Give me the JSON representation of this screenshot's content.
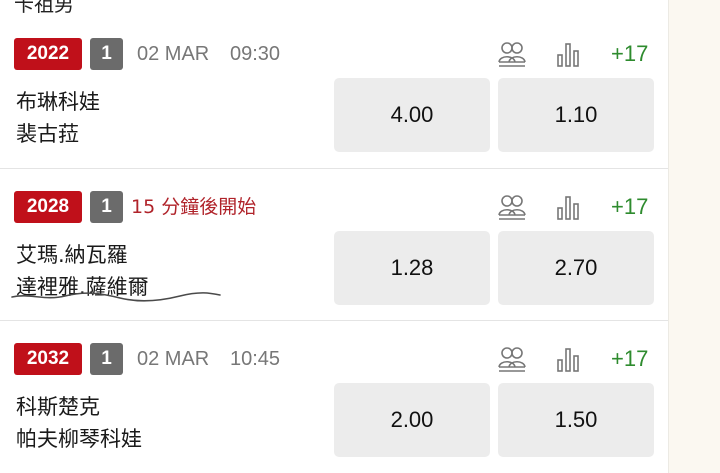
{
  "top_cut_text": "卡祖男",
  "matches": [
    {
      "id": "2022",
      "number": "1",
      "date": "02 MAR",
      "time": "09:30",
      "status": "",
      "more_markets": "+17",
      "home": "布琳科娃",
      "away": "裴古菈",
      "odds": [
        "4.00",
        "1.10"
      ]
    },
    {
      "id": "2028",
      "number": "1",
      "date": "",
      "time": "",
      "status": "15 分鐘後開始",
      "more_markets": "+17",
      "home": "艾瑪.納瓦羅",
      "away": "達裡雅.薩維爾",
      "odds": [
        "1.28",
        "2.70"
      ]
    },
    {
      "id": "2032",
      "number": "1",
      "date": "02 MAR",
      "time": "10:45",
      "status": "",
      "more_markets": "+17",
      "home": "科斯楚克",
      "away": "帕夫柳琴科娃",
      "odds": [
        "2.00",
        "1.50"
      ]
    }
  ],
  "icons": {
    "h2h": "head-to-head-icon",
    "stats": "bar-chart-icon"
  },
  "colors": {
    "id_badge": "#c0101a",
    "num_badge": "#6b6b6b",
    "more_markets": "#2e8b2e",
    "status": "#b0232a",
    "odds_button": "#ececec"
  }
}
